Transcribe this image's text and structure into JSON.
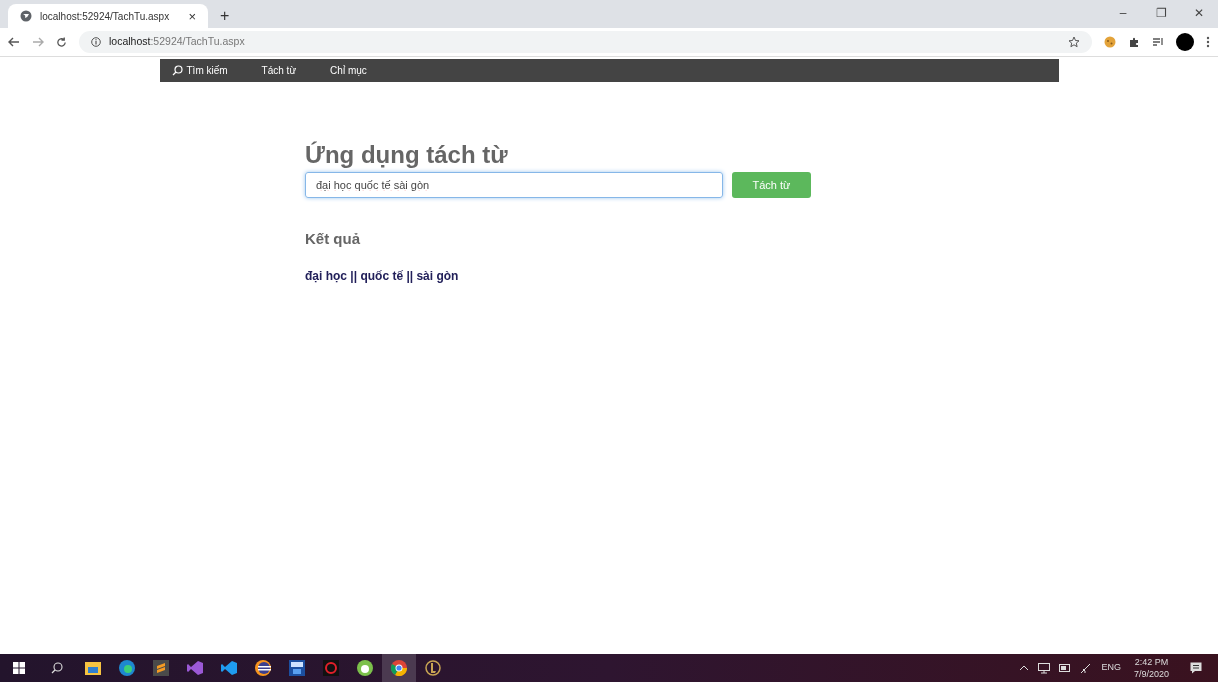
{
  "browser": {
    "tab_title": "localhost:52924/TachTu.aspx",
    "tab_close": "×",
    "new_tab": "+",
    "window_controls": [
      "–",
      "❐",
      "✕"
    ],
    "address_host": "localhost",
    "address_rest": ":52924/TachTu.aspx"
  },
  "nav": {
    "items": [
      {
        "label": "Tìm kiếm",
        "kind": "search"
      },
      {
        "label": "Tách từ",
        "kind": "plain"
      },
      {
        "label": "Chỉ mục",
        "kind": "plain"
      }
    ]
  },
  "page": {
    "title": "Ứng dụng tách từ",
    "input_value": "đại học quốc tế sài gòn",
    "button": "Tách từ",
    "result_heading": "Kết quả",
    "result": "đại học || quốc tế || sài gòn"
  },
  "taskbar": {
    "apps": [
      {
        "kind": "explorer",
        "selected": false
      },
      {
        "kind": "edge",
        "selected": false
      },
      {
        "kind": "sublime",
        "selected": false
      },
      {
        "kind": "vs",
        "selected": false
      },
      {
        "kind": "vscode",
        "selected": false
      },
      {
        "kind": "eclipse",
        "selected": false
      },
      {
        "kind": "devcpp",
        "selected": false
      },
      {
        "kind": "garena",
        "selected": false
      },
      {
        "kind": "coccoc",
        "selected": false
      },
      {
        "kind": "chrome",
        "selected": true
      },
      {
        "kind": "lol",
        "selected": false
      }
    ],
    "language": "ENG",
    "time": "2:42 PM",
    "date": "7/9/2020"
  }
}
